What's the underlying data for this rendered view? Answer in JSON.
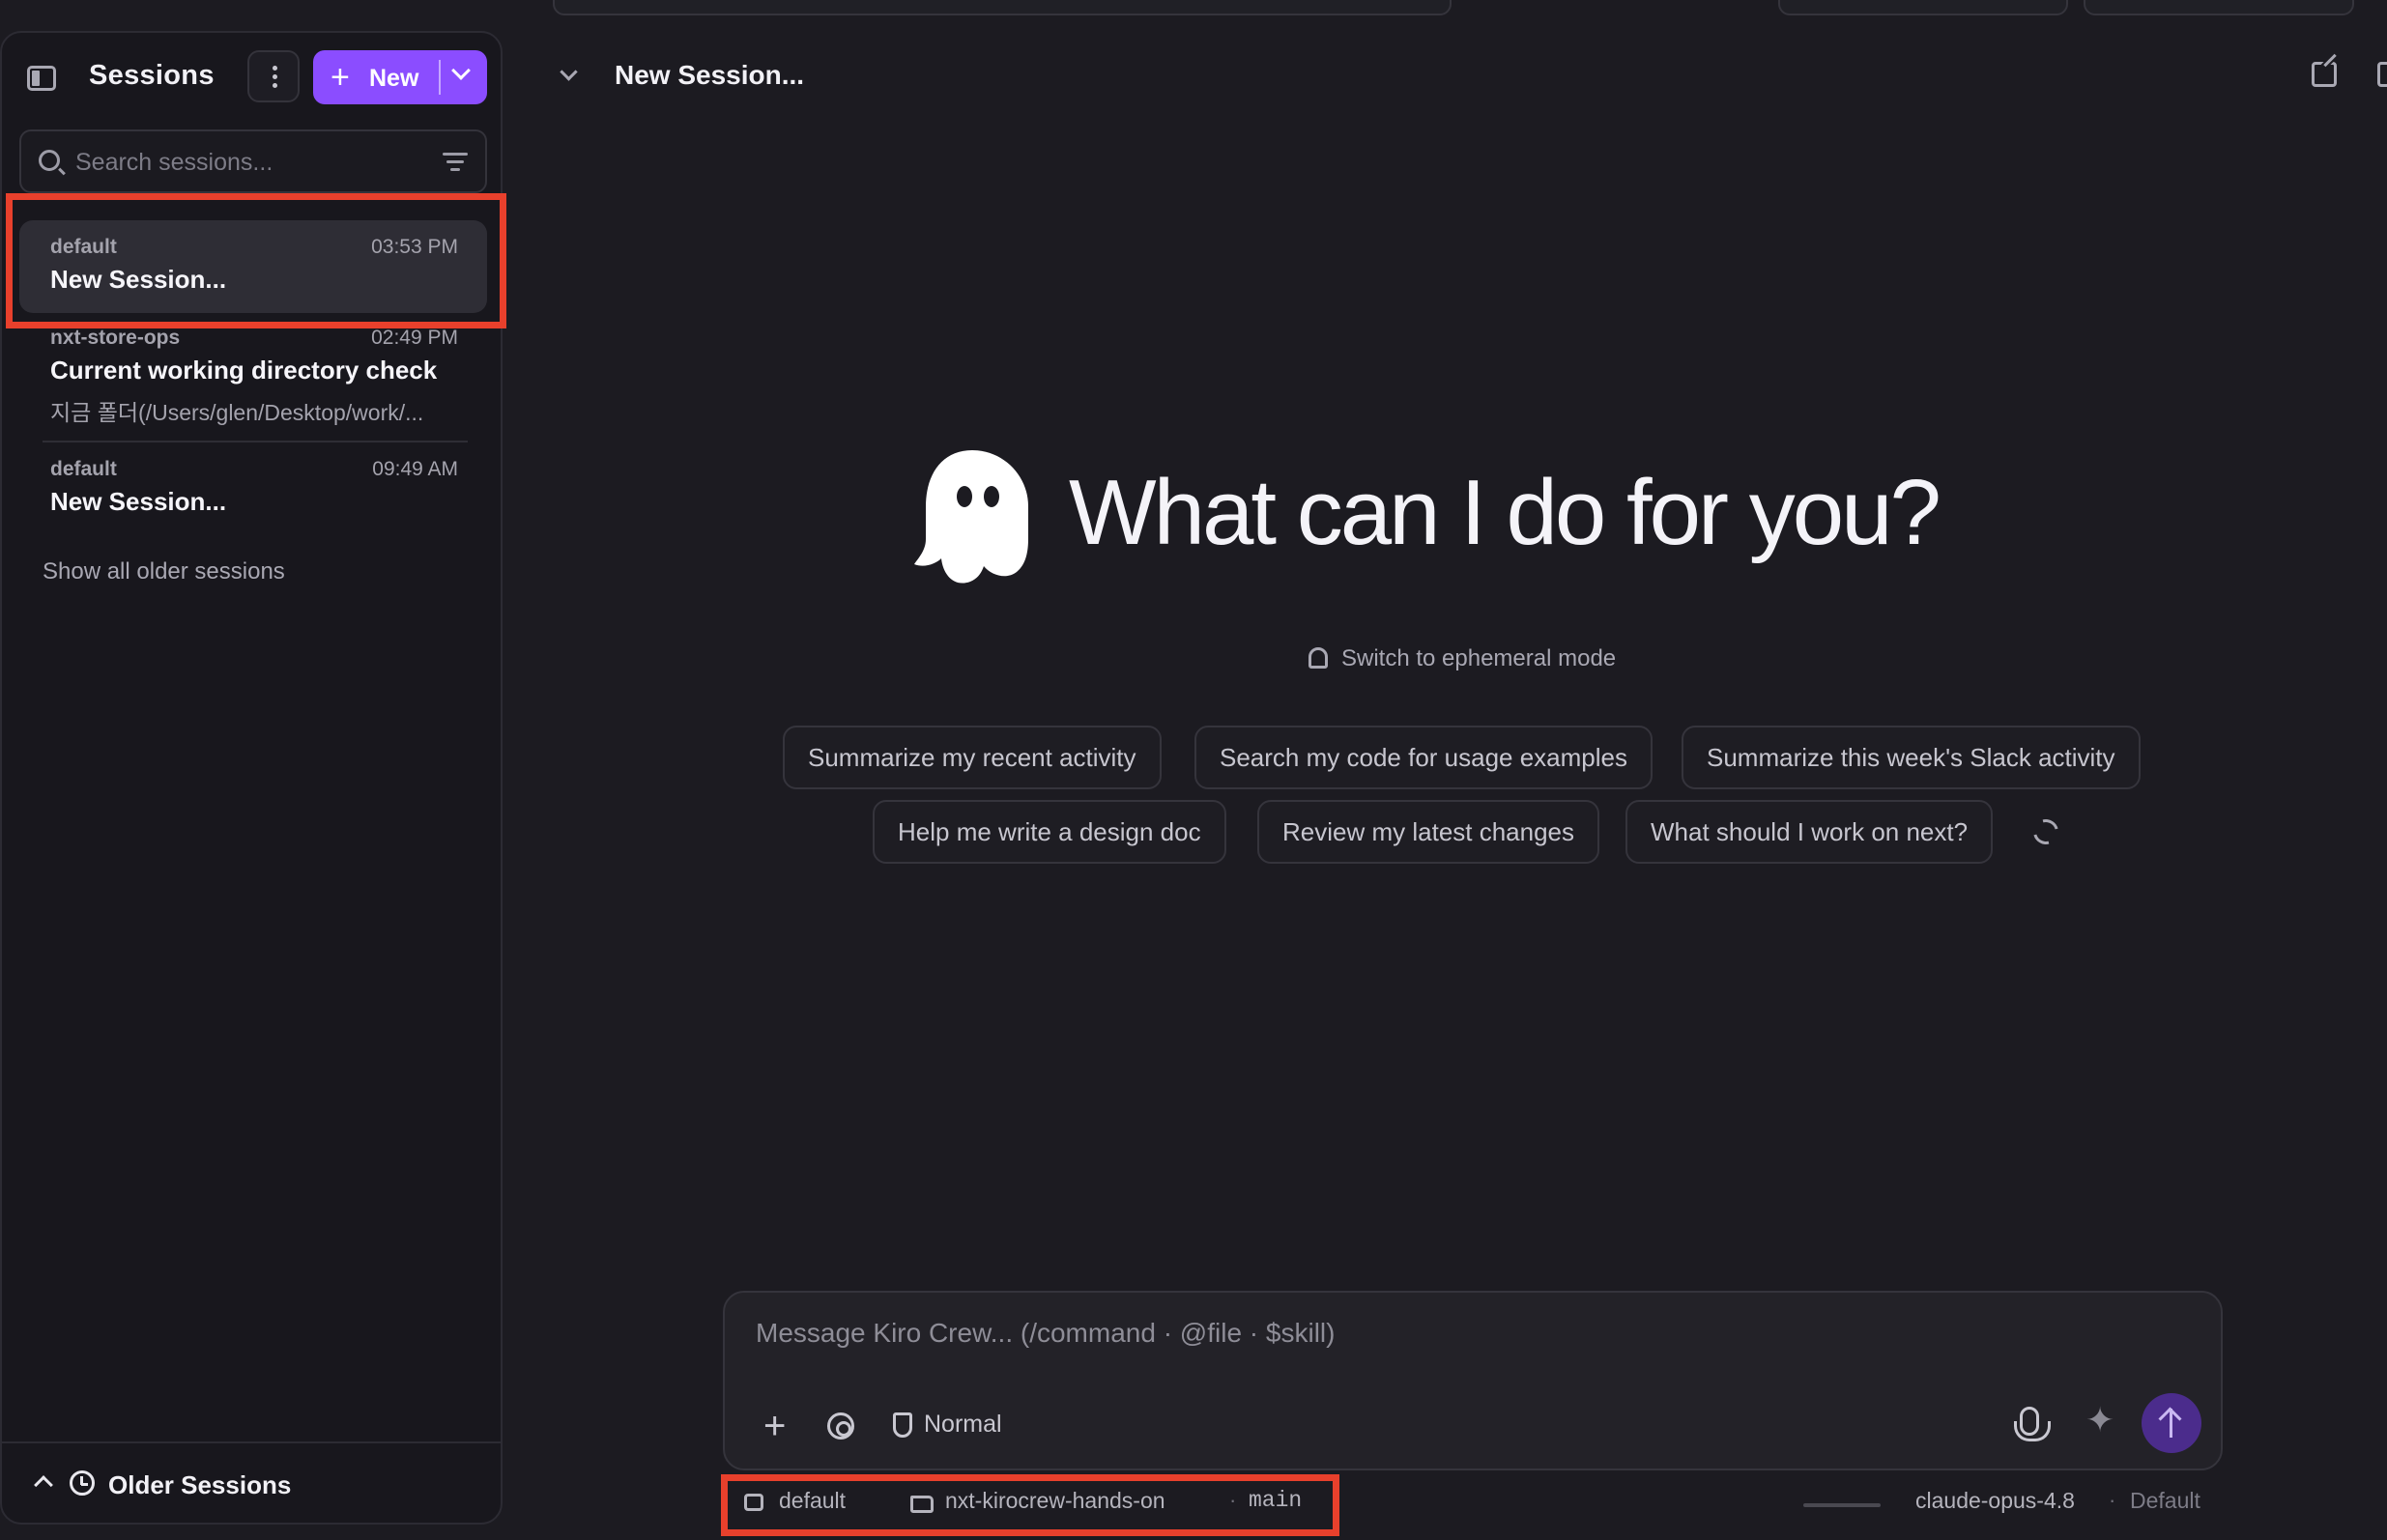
{
  "sidebar": {
    "title": "Sessions",
    "new_button": "New",
    "search_placeholder": "Search sessions...",
    "sessions": [
      {
        "workspace": "default",
        "time": "03:53 PM",
        "title": "New Session...",
        "preview": ""
      },
      {
        "workspace": "nxt-store-ops",
        "time": "02:49 PM",
        "title": "Current working directory check",
        "preview": "지금 폴더(/Users/glen/Desktop/work/..."
      },
      {
        "workspace": "default",
        "time": "09:49 AM",
        "title": "New Session...",
        "preview": ""
      }
    ],
    "show_older": "Show all older sessions",
    "footer_label": "Older Sessions"
  },
  "main": {
    "title": "New Session...",
    "hero": "What can I do for you?",
    "ephemeral": "Switch to ephemeral mode",
    "suggestions": [
      "Summarize my recent activity",
      "Search my code for usage examples",
      "Summarize this week's Slack activity",
      "Help me write a design doc",
      "Review my latest changes",
      "What should I work on next?"
    ]
  },
  "composer": {
    "placeholder": "Message Kiro Crew... (/command · @file · $skill)",
    "mode": "Normal"
  },
  "status": {
    "agent": "default",
    "folder": "nxt-kirocrew-hands-on",
    "branch": "main",
    "model": "claude-opus-4.8",
    "profile": "Default"
  },
  "colors": {
    "accent": "#8b4dff",
    "highlight": "#e8402c",
    "background": "#1c1b21"
  }
}
